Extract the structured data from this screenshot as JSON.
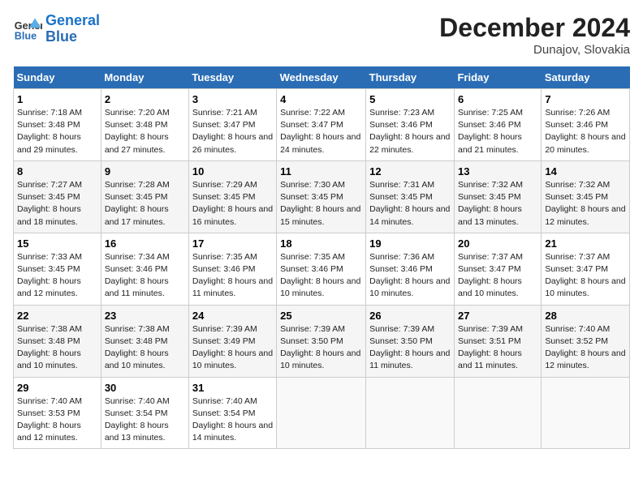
{
  "header": {
    "logo_line1": "General",
    "logo_line2": "Blue",
    "month_title": "December 2024",
    "subtitle": "Dunajov, Slovakia"
  },
  "weekdays": [
    "Sunday",
    "Monday",
    "Tuesday",
    "Wednesday",
    "Thursday",
    "Friday",
    "Saturday"
  ],
  "weeks": [
    [
      {
        "day": "1",
        "sunrise": "7:18 AM",
        "sunset": "3:48 PM",
        "daylight": "8 hours and 29 minutes."
      },
      {
        "day": "2",
        "sunrise": "7:20 AM",
        "sunset": "3:48 PM",
        "daylight": "8 hours and 27 minutes."
      },
      {
        "day": "3",
        "sunrise": "7:21 AM",
        "sunset": "3:47 PM",
        "daylight": "8 hours and 26 minutes."
      },
      {
        "day": "4",
        "sunrise": "7:22 AM",
        "sunset": "3:47 PM",
        "daylight": "8 hours and 24 minutes."
      },
      {
        "day": "5",
        "sunrise": "7:23 AM",
        "sunset": "3:46 PM",
        "daylight": "8 hours and 22 minutes."
      },
      {
        "day": "6",
        "sunrise": "7:25 AM",
        "sunset": "3:46 PM",
        "daylight": "8 hours and 21 minutes."
      },
      {
        "day": "7",
        "sunrise": "7:26 AM",
        "sunset": "3:46 PM",
        "daylight": "8 hours and 20 minutes."
      }
    ],
    [
      {
        "day": "8",
        "sunrise": "7:27 AM",
        "sunset": "3:45 PM",
        "daylight": "8 hours and 18 minutes."
      },
      {
        "day": "9",
        "sunrise": "7:28 AM",
        "sunset": "3:45 PM",
        "daylight": "8 hours and 17 minutes."
      },
      {
        "day": "10",
        "sunrise": "7:29 AM",
        "sunset": "3:45 PM",
        "daylight": "8 hours and 16 minutes."
      },
      {
        "day": "11",
        "sunrise": "7:30 AM",
        "sunset": "3:45 PM",
        "daylight": "8 hours and 15 minutes."
      },
      {
        "day": "12",
        "sunrise": "7:31 AM",
        "sunset": "3:45 PM",
        "daylight": "8 hours and 14 minutes."
      },
      {
        "day": "13",
        "sunrise": "7:32 AM",
        "sunset": "3:45 PM",
        "daylight": "8 hours and 13 minutes."
      },
      {
        "day": "14",
        "sunrise": "7:32 AM",
        "sunset": "3:45 PM",
        "daylight": "8 hours and 12 minutes."
      }
    ],
    [
      {
        "day": "15",
        "sunrise": "7:33 AM",
        "sunset": "3:45 PM",
        "daylight": "8 hours and 12 minutes."
      },
      {
        "day": "16",
        "sunrise": "7:34 AM",
        "sunset": "3:46 PM",
        "daylight": "8 hours and 11 minutes."
      },
      {
        "day": "17",
        "sunrise": "7:35 AM",
        "sunset": "3:46 PM",
        "daylight": "8 hours and 11 minutes."
      },
      {
        "day": "18",
        "sunrise": "7:35 AM",
        "sunset": "3:46 PM",
        "daylight": "8 hours and 10 minutes."
      },
      {
        "day": "19",
        "sunrise": "7:36 AM",
        "sunset": "3:46 PM",
        "daylight": "8 hours and 10 minutes."
      },
      {
        "day": "20",
        "sunrise": "7:37 AM",
        "sunset": "3:47 PM",
        "daylight": "8 hours and 10 minutes."
      },
      {
        "day": "21",
        "sunrise": "7:37 AM",
        "sunset": "3:47 PM",
        "daylight": "8 hours and 10 minutes."
      }
    ],
    [
      {
        "day": "22",
        "sunrise": "7:38 AM",
        "sunset": "3:48 PM",
        "daylight": "8 hours and 10 minutes."
      },
      {
        "day": "23",
        "sunrise": "7:38 AM",
        "sunset": "3:48 PM",
        "daylight": "8 hours and 10 minutes."
      },
      {
        "day": "24",
        "sunrise": "7:39 AM",
        "sunset": "3:49 PM",
        "daylight": "8 hours and 10 minutes."
      },
      {
        "day": "25",
        "sunrise": "7:39 AM",
        "sunset": "3:50 PM",
        "daylight": "8 hours and 10 minutes."
      },
      {
        "day": "26",
        "sunrise": "7:39 AM",
        "sunset": "3:50 PM",
        "daylight": "8 hours and 11 minutes."
      },
      {
        "day": "27",
        "sunrise": "7:39 AM",
        "sunset": "3:51 PM",
        "daylight": "8 hours and 11 minutes."
      },
      {
        "day": "28",
        "sunrise": "7:40 AM",
        "sunset": "3:52 PM",
        "daylight": "8 hours and 12 minutes."
      }
    ],
    [
      {
        "day": "29",
        "sunrise": "7:40 AM",
        "sunset": "3:53 PM",
        "daylight": "8 hours and 12 minutes."
      },
      {
        "day": "30",
        "sunrise": "7:40 AM",
        "sunset": "3:54 PM",
        "daylight": "8 hours and 13 minutes."
      },
      {
        "day": "31",
        "sunrise": "7:40 AM",
        "sunset": "3:54 PM",
        "daylight": "8 hours and 14 minutes."
      },
      null,
      null,
      null,
      null
    ]
  ]
}
